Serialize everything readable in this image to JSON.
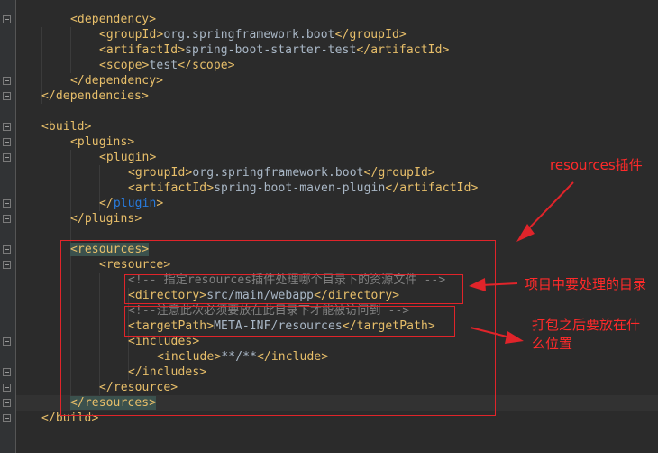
{
  "editor": {
    "lines": [
      {
        "indent": 2,
        "parts": [
          {
            "k": "tag",
            "t": "<dependency>"
          }
        ]
      },
      {
        "indent": 3,
        "parts": [
          {
            "k": "tag",
            "t": "<groupId>"
          },
          {
            "k": "txt",
            "t": "org.springframework.boot"
          },
          {
            "k": "tag",
            "t": "</groupId>"
          }
        ]
      },
      {
        "indent": 3,
        "parts": [
          {
            "k": "tag",
            "t": "<artifactId>"
          },
          {
            "k": "txt",
            "t": "spring-boot-starter-test"
          },
          {
            "k": "tag",
            "t": "</artifactId>"
          }
        ]
      },
      {
        "indent": 3,
        "parts": [
          {
            "k": "tag",
            "t": "<scope>"
          },
          {
            "k": "txt",
            "t": "test"
          },
          {
            "k": "tag",
            "t": "</scope>"
          }
        ]
      },
      {
        "indent": 2,
        "parts": [
          {
            "k": "tag",
            "t": "</dependency>"
          }
        ]
      },
      {
        "indent": 1,
        "parts": [
          {
            "k": "tag",
            "t": "</dependencies>"
          }
        ]
      },
      {
        "indent": 0,
        "parts": []
      },
      {
        "indent": 1,
        "parts": [
          {
            "k": "tag",
            "t": "<build>"
          }
        ]
      },
      {
        "indent": 2,
        "parts": [
          {
            "k": "tag",
            "t": "<plugins>"
          }
        ]
      },
      {
        "indent": 3,
        "parts": [
          {
            "k": "tag",
            "t": "<plugin>"
          }
        ]
      },
      {
        "indent": 4,
        "parts": [
          {
            "k": "tag",
            "t": "<groupId>"
          },
          {
            "k": "txt",
            "t": "org.springframework.boot"
          },
          {
            "k": "tag",
            "t": "</groupId>"
          }
        ]
      },
      {
        "indent": 4,
        "parts": [
          {
            "k": "tag",
            "t": "<artifactId>"
          },
          {
            "k": "txt",
            "t": "spring-boot-maven-plugin"
          },
          {
            "k": "tag",
            "t": "</artifactId>"
          }
        ]
      },
      {
        "indent": 3,
        "parts": [
          {
            "k": "tag",
            "t": "</"
          },
          {
            "k": "link",
            "t": "plugin"
          },
          {
            "k": "tag",
            "t": ">"
          }
        ]
      },
      {
        "indent": 2,
        "parts": [
          {
            "k": "tag",
            "t": "</plugins>"
          }
        ]
      },
      {
        "indent": 0,
        "parts": []
      },
      {
        "indent": 2,
        "parts": [
          {
            "k": "tag hl",
            "t": "<resources>"
          }
        ]
      },
      {
        "indent": 3,
        "parts": [
          {
            "k": "tag",
            "t": "<resource>"
          }
        ]
      },
      {
        "indent": 4,
        "parts": [
          {
            "k": "cmt",
            "t": "<!-- 指定resources插件处理哪个目录下的资源文件 -->"
          }
        ]
      },
      {
        "indent": 4,
        "parts": [
          {
            "k": "tag",
            "t": "<directory>"
          },
          {
            "k": "txt",
            "t": "src/main/webapp"
          },
          {
            "k": "tag",
            "t": "</directory>"
          }
        ]
      },
      {
        "indent": 4,
        "parts": [
          {
            "k": "cmt",
            "t": "<!--注意此次必须要放在此目录下才能被访问到 -->"
          }
        ]
      },
      {
        "indent": 4,
        "parts": [
          {
            "k": "tag",
            "t": "<targetPath>"
          },
          {
            "k": "txt",
            "t": "META-INF/resources"
          },
          {
            "k": "tag",
            "t": "</targetPath>"
          }
        ]
      },
      {
        "indent": 4,
        "parts": [
          {
            "k": "tag",
            "t": "<includes>"
          }
        ]
      },
      {
        "indent": 5,
        "parts": [
          {
            "k": "tag",
            "t": "<include>"
          },
          {
            "k": "txt",
            "t": "**/**"
          },
          {
            "k": "tag",
            "t": "</include>"
          }
        ]
      },
      {
        "indent": 4,
        "parts": [
          {
            "k": "tag",
            "t": "</includes>"
          }
        ]
      },
      {
        "indent": 3,
        "parts": [
          {
            "k": "tag",
            "t": "</resource>"
          }
        ]
      },
      {
        "indent": 2,
        "parts": [
          {
            "k": "tag hl",
            "t": "</resources>"
          }
        ]
      },
      {
        "indent": 1,
        "parts": [
          {
            "k": "tag",
            "t": "</build>"
          }
        ]
      }
    ]
  },
  "annotations": {
    "resources_plugin": "resources插件",
    "dir_to_process": "项目中要处理的目录",
    "after_package_line1": "打包之后要放在什",
    "after_package_line2": "么位置"
  },
  "colors": {
    "background": "#2b2b2b",
    "tag": "#e8bf6a",
    "text": "#a9b7c6",
    "comment": "#808080",
    "annotation": "#ff2a2a"
  }
}
